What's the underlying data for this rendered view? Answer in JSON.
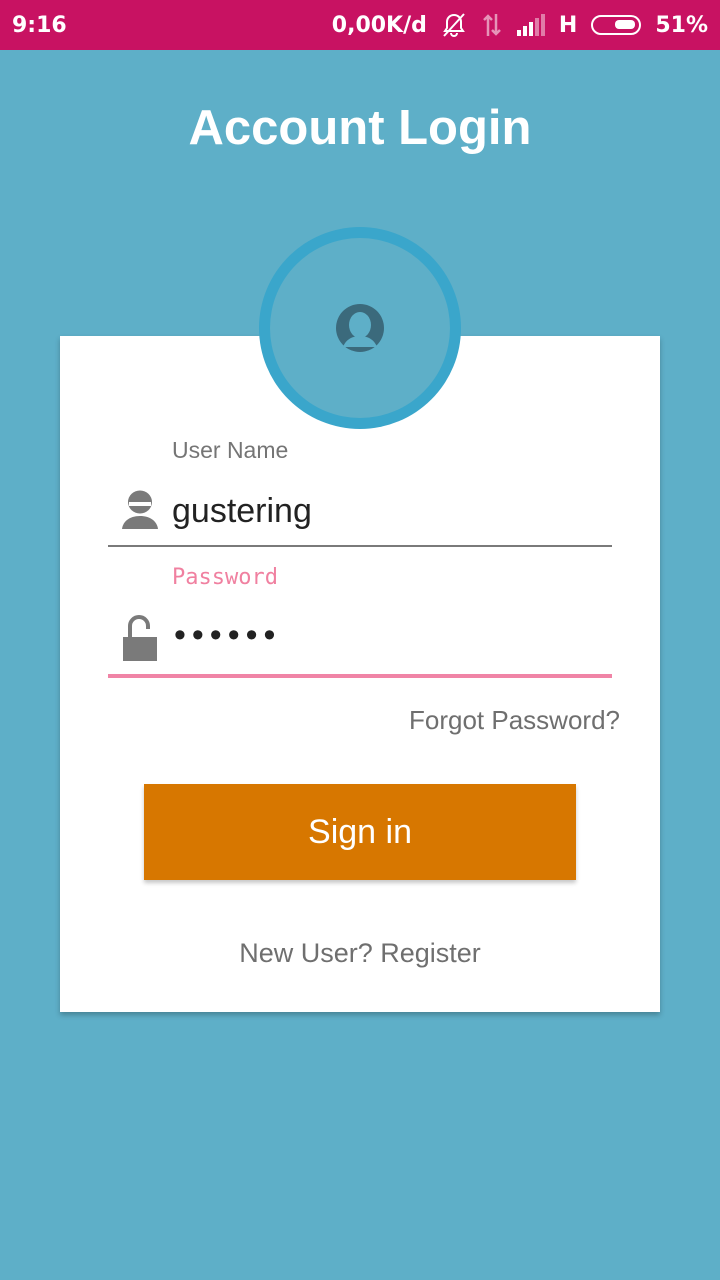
{
  "status_bar": {
    "time": "9:16",
    "net_speed": "0,00K/d",
    "network_type": "H",
    "battery": "51%",
    "battery_level": 0.51,
    "icons": [
      "mute-notification-icon",
      "data-transfer-icon",
      "signal-icon",
      "battery-icon"
    ]
  },
  "header": {
    "title": "Account Login"
  },
  "avatar": {
    "icon": "user-avatar-icon",
    "ring_color": "#3aa6cb"
  },
  "form": {
    "username": {
      "label": "User Name",
      "value": "gustering",
      "icon": "user-icon"
    },
    "password": {
      "label": "Password",
      "value": "••••••",
      "icon": "unlocked-padlock-icon"
    },
    "forgot_label": "Forgot Password?",
    "signin_label": "Sign in",
    "register_label": "New User? Register"
  },
  "colors": {
    "status_bar": "#c81262",
    "background": "#5eafc8",
    "accent": "#d77700",
    "focus_underline": "#f084a6",
    "card": "#ffffff"
  }
}
